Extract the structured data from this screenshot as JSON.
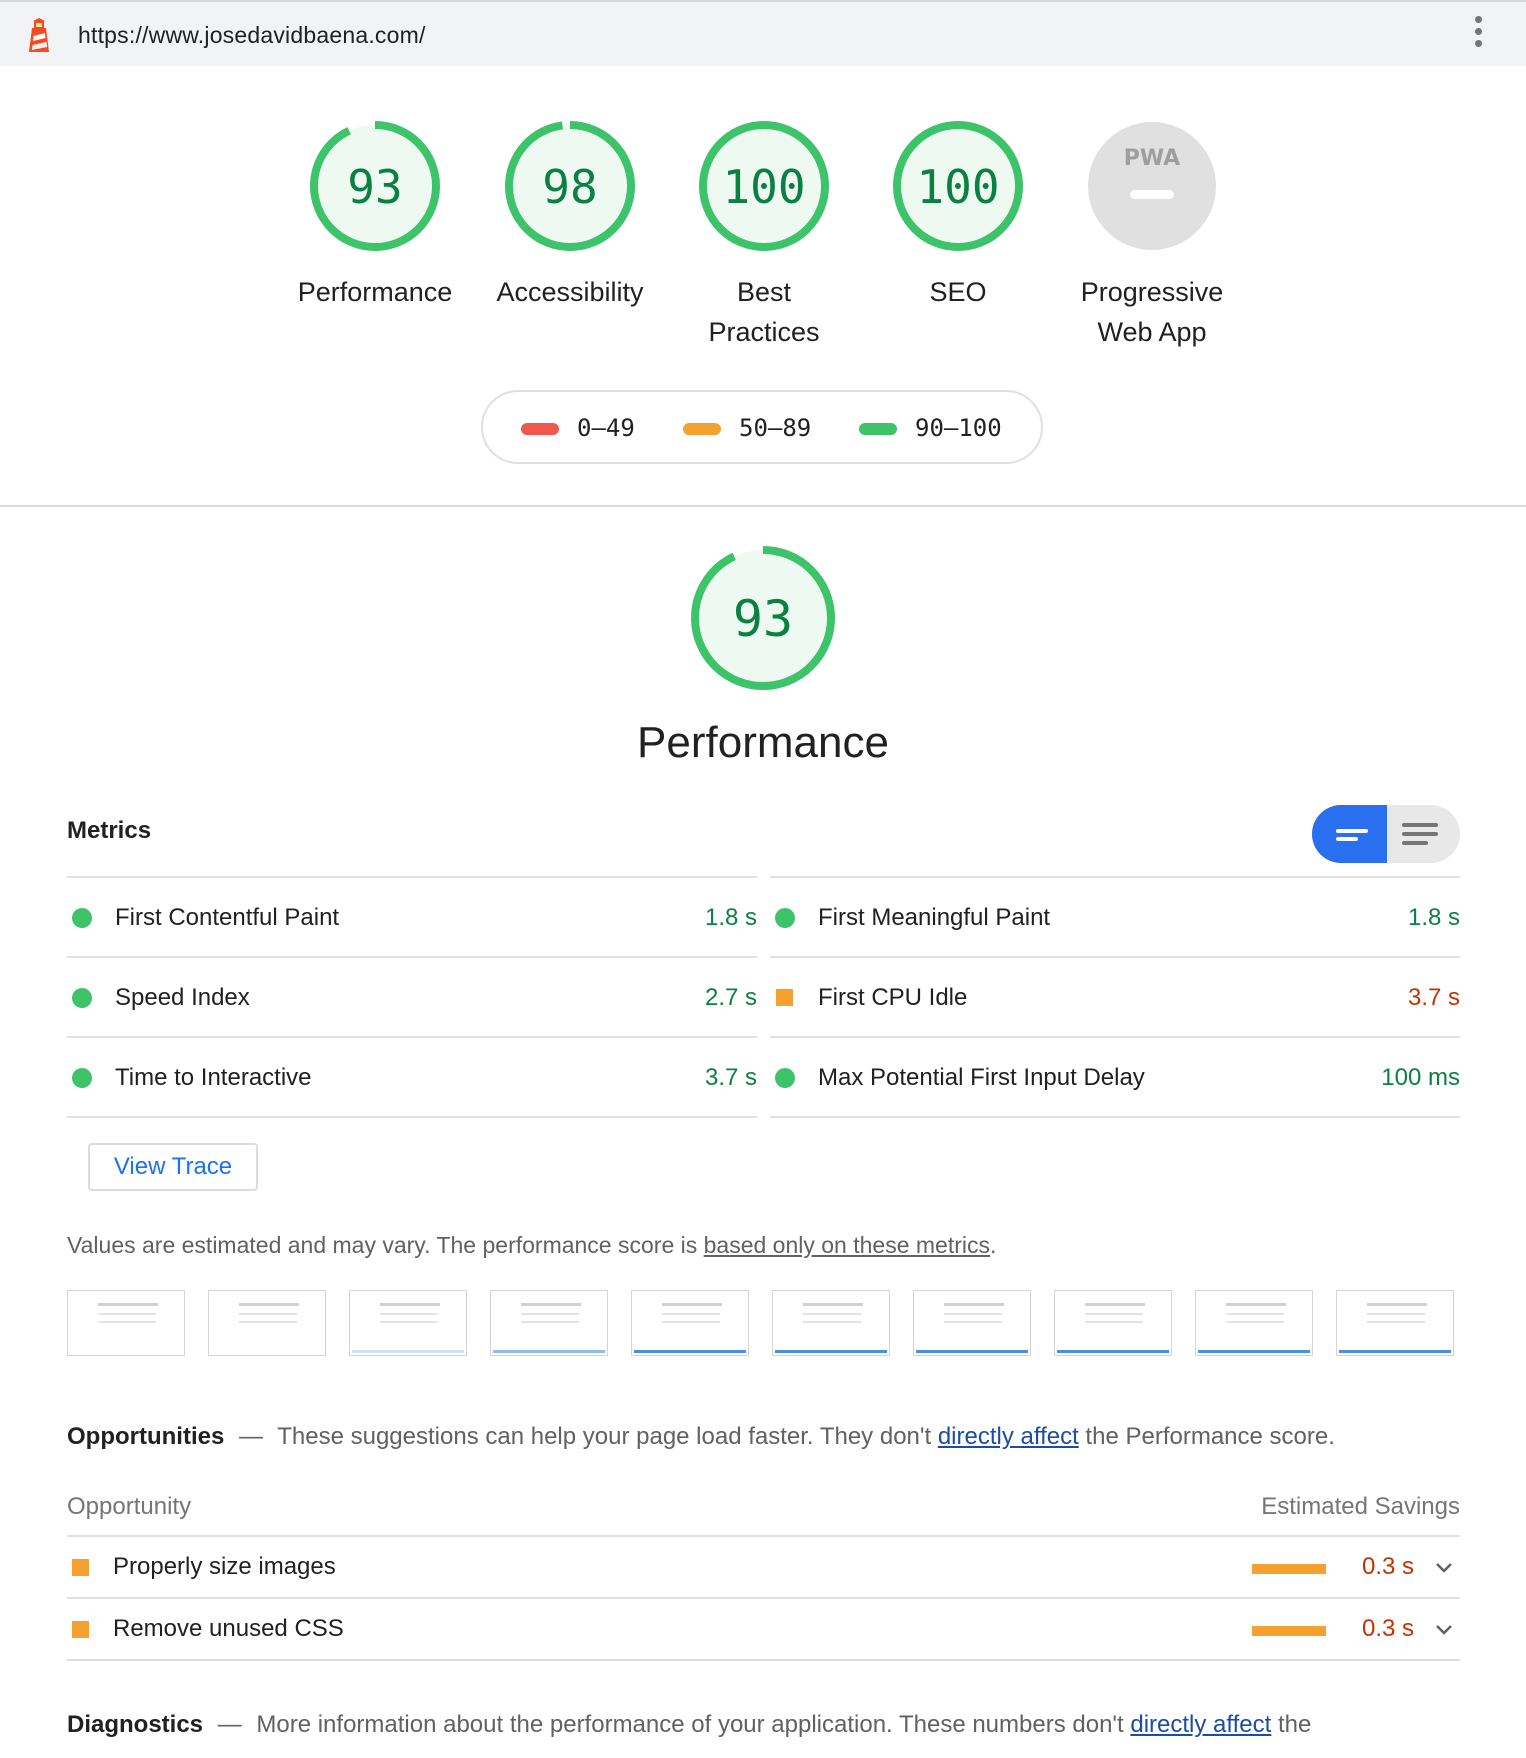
{
  "toolbar": {
    "url": "https://www.josedavidbaena.com/",
    "menu_icon": "more-vert-icon"
  },
  "categories": [
    {
      "label": "Performance",
      "score": "93",
      "value": 93
    },
    {
      "label": "Accessibility",
      "score": "98",
      "value": 98
    },
    {
      "label": "Best Practices",
      "score": "100",
      "value": 100
    },
    {
      "label": "SEO",
      "score": "100",
      "value": 100
    },
    {
      "label": "Progressive Web App",
      "badge": "PWA"
    }
  ],
  "legend": [
    {
      "range": "0–49",
      "color": "#f0584c"
    },
    {
      "range": "50–89",
      "color": "#f5a12f"
    },
    {
      "range": "90–100",
      "color": "#3dc36a"
    }
  ],
  "performance": {
    "score": "93",
    "value": 93,
    "title": "Performance",
    "metrics_title": "Metrics",
    "metrics": [
      {
        "name": "First Contentful Paint",
        "value": "1.8 s",
        "status": "pass"
      },
      {
        "name": "Speed Index",
        "value": "2.7 s",
        "status": "pass"
      },
      {
        "name": "Time to Interactive",
        "value": "3.7 s",
        "status": "pass"
      },
      {
        "name": "First Meaningful Paint",
        "value": "1.8 s",
        "status": "pass"
      },
      {
        "name": "First CPU Idle",
        "value": "3.7 s",
        "status": "average"
      },
      {
        "name": "Max Potential First Input Delay",
        "value": "100 ms",
        "status": "pass"
      }
    ],
    "view_trace": "View Trace",
    "note_prefix": "Values are estimated and may vary. The performance score is ",
    "note_link": "based only on these metrics",
    "note_suffix": "."
  },
  "opportunities": {
    "title": "Opportunities",
    "dash": "—",
    "desc_prefix": "These suggestions can help your page load faster. They don't ",
    "desc_link": "directly affect",
    "desc_suffix": " the Performance score.",
    "col_left": "Opportunity",
    "col_right": "Estimated Savings",
    "items": [
      {
        "name": "Properly size images",
        "savings": "0.3 s"
      },
      {
        "name": "Remove unused CSS",
        "savings": "0.3 s"
      }
    ]
  },
  "diagnostics": {
    "title": "Diagnostics",
    "dash": "—",
    "desc_prefix": "More information about the performance of your application. These numbers don't ",
    "desc_link": "directly affect",
    "desc_suffix": " the"
  },
  "colors": {
    "pass": "#0b8043",
    "average": "#c33300",
    "ring": "#3dc36a",
    "accent": "#2a6ff0"
  }
}
